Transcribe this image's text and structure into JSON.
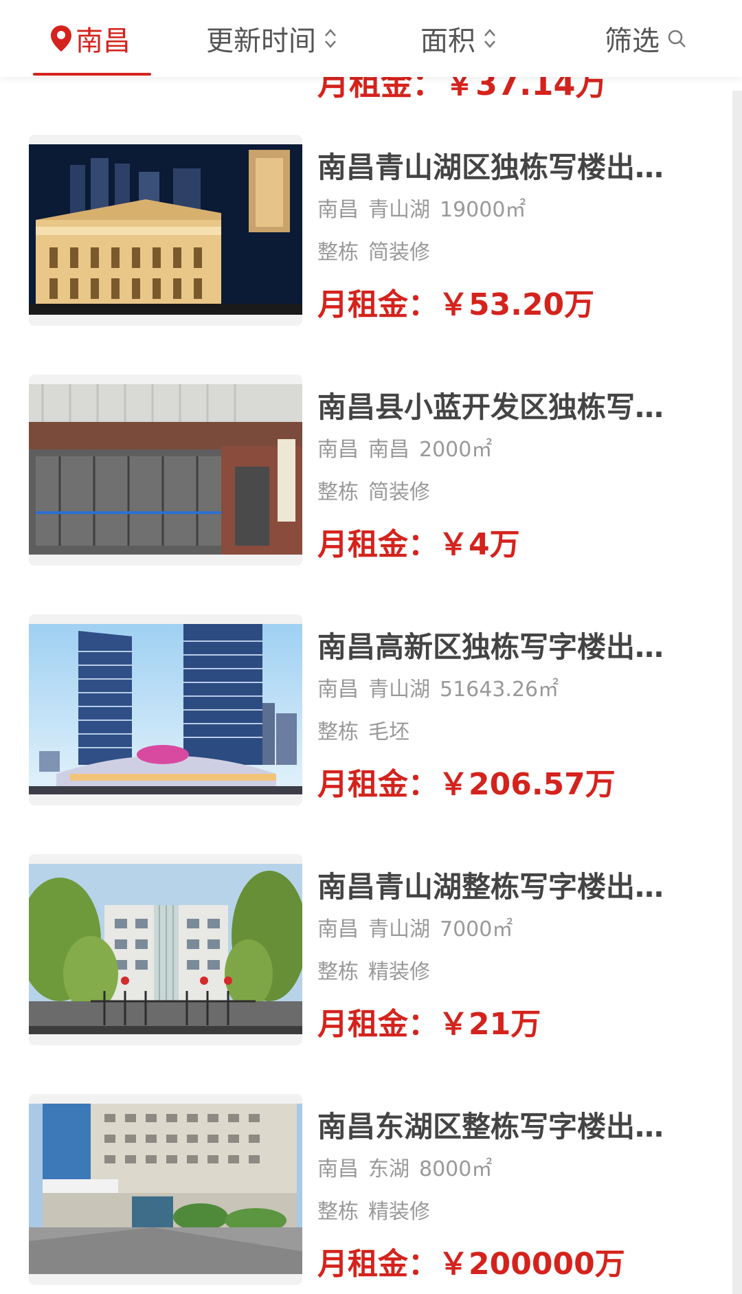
{
  "colors": {
    "accent": "#d4231d",
    "title_text": "#444444",
    "meta_text": "#999999",
    "tab_text": "#555555"
  },
  "filter_bar": {
    "city": "南昌",
    "sort_time": "更新时间",
    "sort_area": "面积",
    "filter": "筛选",
    "icons": {
      "city": "location-pin-icon",
      "sort_time": "sort-updown-icon",
      "sort_area": "sort-updown-icon",
      "filter": "search-icon"
    }
  },
  "prev_listing": {
    "price": "月租金：￥37.14万"
  },
  "listings": [
    {
      "title": "南昌青山湖区独栋写楼出…",
      "city": "南昌",
      "district": "青山湖",
      "area": "19000㎡",
      "type": "整栋",
      "decoration": "简装修",
      "price_label": "月租金：",
      "price": "￥53.20万"
    },
    {
      "title": "南昌县小蓝开发区独栋写…",
      "city": "南昌",
      "district": "南昌",
      "area": "2000㎡",
      "type": "整栋",
      "decoration": "简装修",
      "price_label": "月租金：",
      "price": "￥4万"
    },
    {
      "title": "南昌高新区独栋写字楼出…",
      "city": "南昌",
      "district": "青山湖",
      "area": "51643.26㎡",
      "type": "整栋",
      "decoration": "毛坯",
      "price_label": "月租金：",
      "price": "￥206.57万"
    },
    {
      "title": "南昌青山湖整栋写字楼出…",
      "city": "南昌",
      "district": "青山湖",
      "area": "7000㎡",
      "type": "整栋",
      "decoration": "精装修",
      "price_label": "月租金：",
      "price": "￥21万"
    },
    {
      "title": "南昌东湖区整栋写字楼出…",
      "city": "南昌",
      "district": "东湖",
      "area": "8000㎡",
      "type": "整栋",
      "decoration": "精装修",
      "price_label": "月租金：",
      "price": "￥200000万"
    }
  ]
}
